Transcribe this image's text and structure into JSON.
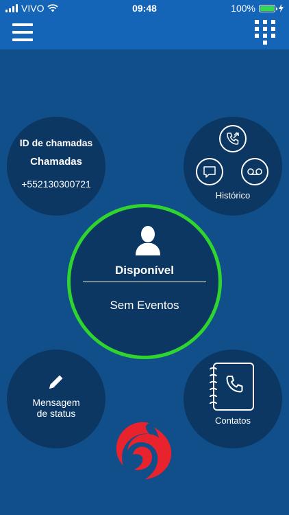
{
  "status_bar": {
    "carrier": "VIVO",
    "time": "09:48",
    "battery": "100%",
    "battery_level": 1.0
  },
  "app_bar": {
    "menu_icon": "hamburger-icon",
    "dialpad_icon": "dialpad-icon"
  },
  "call_id": {
    "title": "ID de chamadas",
    "subtitle": "Chamadas",
    "number": "+552130300721"
  },
  "history": {
    "label": "Histórico",
    "icons": [
      "call-icon",
      "chat-icon",
      "voicemail-icon"
    ]
  },
  "presence": {
    "status": "Disponível",
    "events": "Sem Eventos",
    "ring_color": "#30d42e"
  },
  "status_message": {
    "line1": "Mensagem",
    "line2": "de status"
  },
  "contacts": {
    "label": "Contatos"
  },
  "colors": {
    "background": "#104f89",
    "bar": "#1465b8",
    "circle": "#0c3763",
    "logo": "#e8232e"
  }
}
